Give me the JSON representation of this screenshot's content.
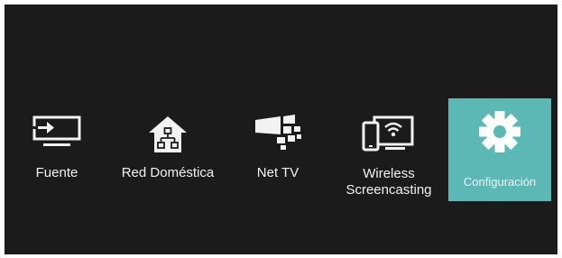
{
  "menu": {
    "selected_index": 4,
    "accent_color": "#5bb8b4",
    "items": [
      {
        "icon": "source-input-icon",
        "label": "Fuente"
      },
      {
        "icon": "home-network-icon",
        "label": "Red Doméstica"
      },
      {
        "icon": "net-tv-icon",
        "label": "Net TV"
      },
      {
        "icon": "wireless-screencasting-icon",
        "label_line1": "Wireless",
        "label_line2": "Screencasting"
      },
      {
        "icon": "gear-icon",
        "label": "Configuración"
      }
    ]
  }
}
